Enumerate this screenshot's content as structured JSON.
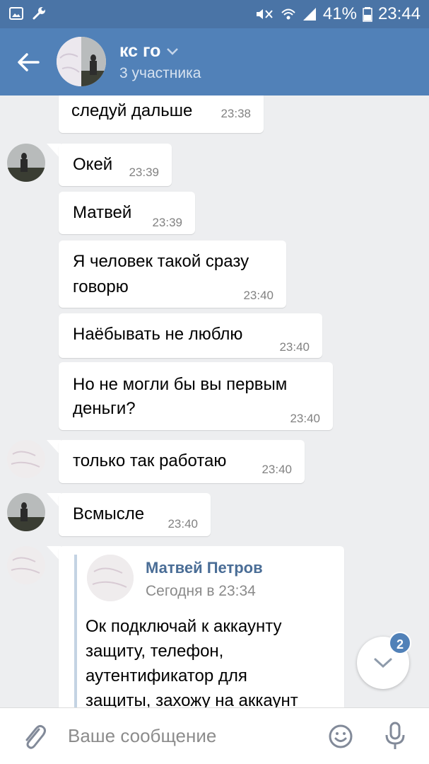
{
  "status_bar": {
    "battery": "41%",
    "time": "23:44"
  },
  "header": {
    "title": "кс го",
    "subtitle": "3 участника"
  },
  "messages": [
    {
      "text": "следуй дальше",
      "time": "23:38"
    },
    {
      "text": "Окей",
      "time": "23:39"
    },
    {
      "text": "Матвей",
      "time": "23:39"
    },
    {
      "text_lines": [
        "Я человек такой сразу",
        "говорю"
      ],
      "time": "23:40"
    },
    {
      "text": "Наёбывать не люблю",
      "time": "23:40"
    },
    {
      "text_lines": [
        "Но не могли бы вы первым",
        "деньги?"
      ],
      "time": "23:40"
    },
    {
      "text": "только так работаю",
      "time": "23:40"
    },
    {
      "text": "Всмысле",
      "time": "23:40"
    }
  ],
  "forwarded": {
    "name": "Матвей Петров",
    "date": "Сегодня в 23:34",
    "lines": [
      "Ок подключай к аккаунту",
      "защиту, телефон,",
      "аутентификатор для",
      "защиты, захожу на аккаунт"
    ]
  },
  "scroll_badge": "2",
  "composer": {
    "placeholder": "Ваше сообщение"
  },
  "colors": {
    "header": "#5181b8",
    "status_bar": "#4a74a6",
    "background": "#edeef0",
    "badge": "#5181b8"
  }
}
